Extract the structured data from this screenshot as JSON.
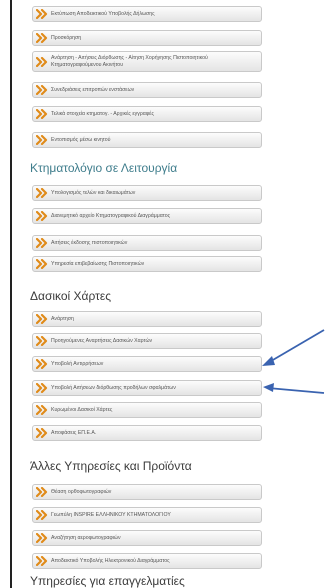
{
  "colors": {
    "chevron": "#e08b1a",
    "heading_teal": "#3f7d8c",
    "arrow": "#3a63b0"
  },
  "section1": {
    "items": [
      "Εκτύπωση Αποδεικτικού Υποβολής Δήλωσης",
      "Προσκόρηση",
      "Ανάρτηση - Αιτήσεις Διόρθωσης - Αίτηση Χορήγησης Πιστοποιητικού Κτηματογραφούμενου Ακινήτου",
      "Συνεδριάσεις επιτροπών ενστάσεων",
      "Τελικά στοιχεία κτηματογ. - Αρχικές εγγραφές",
      "Εντοπισμός μέσω κινητού"
    ]
  },
  "section2": {
    "title": "Κτηματολόγιο σε Λειτουργία",
    "items": [
      "Υπολογισμός τελών και δικαιωμάτων",
      "Διανεμητικό αρχείο Κτηματογραφικού Διαγράμματος",
      "Αιτήσεις έκδοσης πιστοποιητικών",
      "Υπηρεσία επιβεβαίωσης Πιστοποιητικών"
    ]
  },
  "section3": {
    "title": "Δασικοί Χάρτες",
    "items": [
      "Ανάρτηση",
      "Προηγούμενες Αναρτήσεις Δασικών Χαρτών",
      "Υποβολή Αντιρρήσεων",
      "Υποβολή Αιτήσεων διόρθωσης προδήλων σφαλμάτων",
      "Κυρωμένοι Δασικοί Χάρτες",
      "Αποφάσεις ΕΠ.Ε.Α."
    ]
  },
  "section4": {
    "title": "Άλλες Υπηρεσίες και Προϊόντα",
    "items": [
      "Θέαση ορθοφωτογραφιών",
      "Γεωπύλη INSPIRE ΕΛΛΗΝΙΚΟΥ ΚΤΗΜΑΤΟΛΟΓΙΟΥ",
      "Αναζήτηση αεροφωτογραφιών",
      "Αποδεικτικό Υποβολής Ηλεκτρονικού Διαγράμματος"
    ]
  },
  "section5": {
    "title": "Υπηρεσίες για επαγγελματίες"
  }
}
